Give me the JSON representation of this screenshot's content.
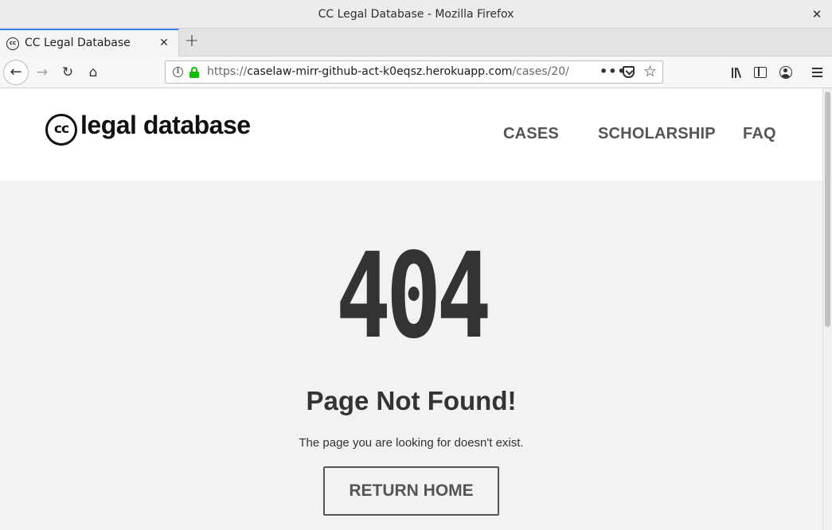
{
  "window": {
    "title": "CC Legal Database - Mozilla Firefox"
  },
  "tabs": [
    {
      "label": "CC Legal Database"
    }
  ],
  "urlbar": {
    "scheme": "https://",
    "domain": "caselaw-mirr-github-act-k0eqsz.herokuapp.com",
    "path": "/cases/20/",
    "more": "•••"
  },
  "site": {
    "logo_mark": "cc",
    "logo_text": "legal database",
    "nav": [
      {
        "label": "CASES"
      },
      {
        "label": "SCHOLARSHIP"
      },
      {
        "label": "FAQ"
      }
    ]
  },
  "error": {
    "code": "404",
    "headline": "Page Not Found!",
    "message": "The page you are looking for doesn't exist.",
    "button": "RETURN HOME"
  },
  "colors": {
    "secure_lock": "#12bc00",
    "active_tab_accent": "#3b86e6",
    "page_background": "#f2f2f2",
    "heading_text": "#333333"
  }
}
